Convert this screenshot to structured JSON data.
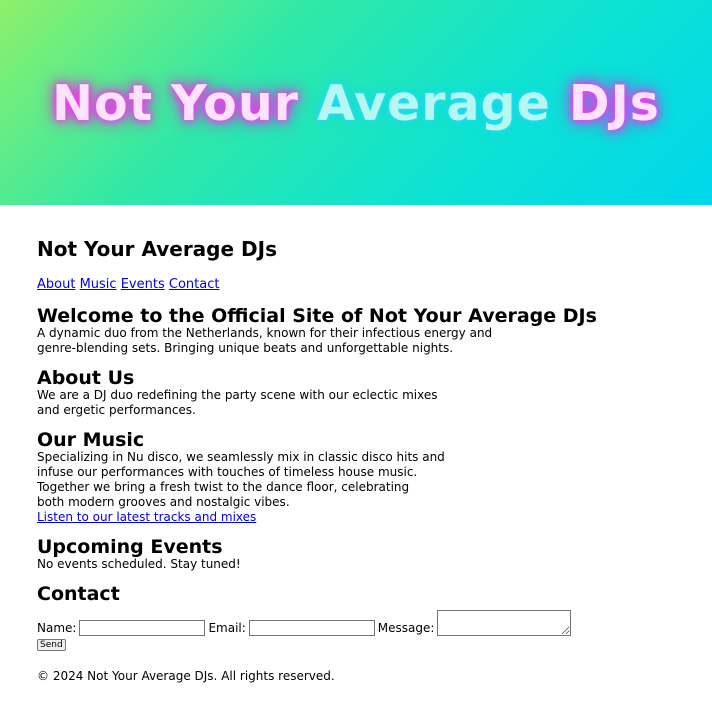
{
  "banner": {
    "title_part1": "Not Your ",
    "title_part2": "Average ",
    "title_part3": "DJs"
  },
  "site_title": "Not Your Average DJs",
  "nav": {
    "about": "About",
    "music": "Music",
    "events": "Events",
    "contact": "Contact"
  },
  "intro": {
    "heading": "Welcome to the Official Site of Not Your Average DJs",
    "line1": "A dynamic duo from the Netherlands, known for their infectious energy and",
    "line2": "genre-blending sets. Bringing unique beats and unforgettable nights."
  },
  "about": {
    "heading": "About Us",
    "line1": "We are a DJ duo redefining the party scene with our eclectic mixes",
    "line2": "and ergetic performances."
  },
  "music": {
    "heading": "Our Music",
    "line1": "Specializing in Nu disco, we seamlessly mix in classic disco hits and",
    "line2": "infuse our performances with touches of timeless house music.",
    "line3": "Together we bring a fresh twist to the dance floor, celebrating",
    "line4": "both modern grooves and nostalgic vibes.",
    "link": "Listen to our latest tracks and mixes"
  },
  "events": {
    "heading": "Upcoming Events",
    "text": "No events scheduled. Stay tuned!"
  },
  "contact": {
    "heading": "Contact",
    "name_label": "Name:",
    "name_value": "",
    "email_label": "Email:",
    "email_value": "",
    "message_label": "Message:",
    "message_value": "",
    "send_label": "Send"
  },
  "footer": {
    "text": "© 2024 Not Your Average DJs. All rights reserved."
  },
  "colors": {
    "banner_pink_glow": "#ff2ef2",
    "banner_cyan_glow": "#14d3e8",
    "link": "#0000ee"
  }
}
